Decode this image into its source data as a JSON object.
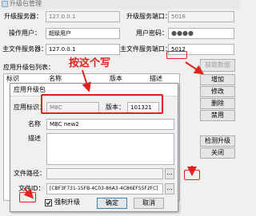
{
  "window": {
    "title": "升级包管理"
  },
  "server": {
    "upgrade_server_label": "升级服务器：",
    "upgrade_server_value": "127.0.0.1",
    "upgrade_port_label": "升级服务端口：",
    "upgrade_port_value": "5018",
    "operator_label": "操作用户：",
    "operator_value": "超级用户",
    "password_label": "用户密码：",
    "password_value": "●●●●",
    "main_server_label": "主文件服务器：",
    "main_server_value": "127.0.0.1",
    "main_port_label": "主文件服务端口：",
    "main_port_value": "5012",
    "fetch_button": "获取数据"
  },
  "package_list": {
    "label": "应用升级包列表：",
    "columns": [
      "标识",
      "名称",
      "版本",
      "描述"
    ]
  },
  "actions": {
    "add": "增加",
    "edit": "修改",
    "delete": "删除",
    "disable": "禁用",
    "check": "检测升级",
    "close": "关闭"
  },
  "annotation": {
    "text": "按这个写",
    "color": "#e3221c"
  },
  "dialog": {
    "title": "应用升级包",
    "app_id_label": "应用标识：",
    "app_id_value": "MBC",
    "version_label": "版本：",
    "version_value": "101321",
    "name_label": "名称",
    "name_value": "MBC new2",
    "desc_label": "描述",
    "desc_value": "",
    "file_path_label": "文件路径：",
    "file_path_value": "",
    "browse_label": "...",
    "file_id_label": "文件ID：",
    "file_id_value": "[CBF3F731-15FB-4C03-86A3-4C86EF55F2FC]",
    "force_upgrade_label": "强制升级",
    "force_upgrade_checked": true,
    "ok_button": "确定",
    "cancel_button": "取消"
  }
}
